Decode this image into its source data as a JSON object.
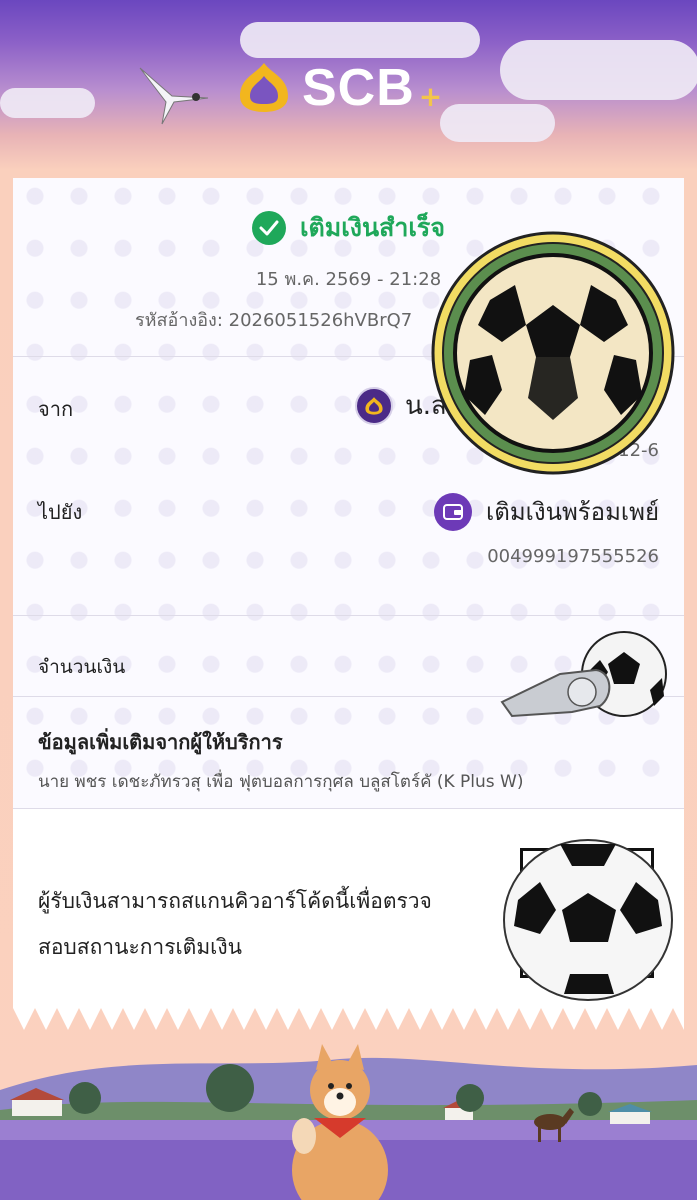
{
  "brand": {
    "name": "SCB",
    "plus": "+"
  },
  "status": {
    "text": "เติมเงินสำเร็จ"
  },
  "datetime": "15 พ.ค. 2569 - 21:28",
  "reference": {
    "label": "รหัสอ้างอิง:",
    "value": "2026051526hVBrQ7"
  },
  "from": {
    "label": "จาก",
    "name": "น.ส",
    "account": "xxx-xxx412-6"
  },
  "to": {
    "label": "ไปยัง",
    "name": "เติมเงินพร้อมเพย์",
    "account": "004999197555526"
  },
  "amount": {
    "label": "จำนวนเงิน"
  },
  "extra": {
    "title": "ข้อมูลเพิ่มเติมจากผู้ให้บริการ",
    "description": "นาย พชร เดชะภัทรวสุ เพื่อ ฟุตบอลการกุศล บลูสโตร์คั (K Plus W)"
  },
  "qr": {
    "text": "ผู้รับเงินสามารถสแกนคิวอาร์โค้ดนี้เพื่อตรวจสอบสถานะการเติมเงิน"
  },
  "colors": {
    "success": "#1fa85a",
    "brand_purple": "#4b2a87",
    "gold": "#f3c54b"
  }
}
